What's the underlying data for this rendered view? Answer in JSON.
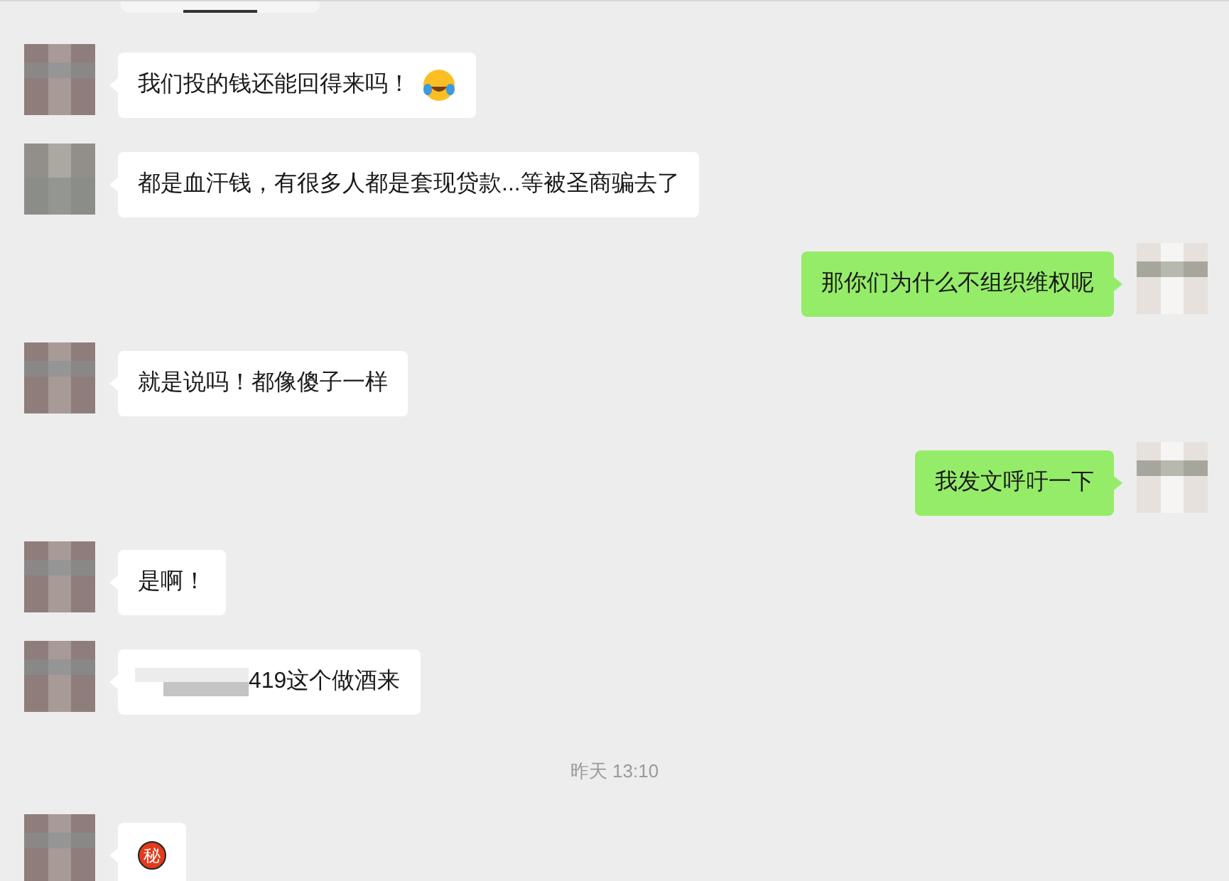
{
  "messages": [
    {
      "kind": "fragment"
    },
    {
      "kind": "text_emoji",
      "outgoing": false,
      "text": "我们投的钱还能回得来吗！"
    },
    {
      "kind": "text",
      "outgoing": false,
      "text": "都是血汗钱，有很多人都是套现贷款...等被圣商骗去了"
    },
    {
      "kind": "text",
      "outgoing": true,
      "text": "那你们为什么不组织维权呢"
    },
    {
      "kind": "text",
      "outgoing": false,
      "text": "就是说吗！都像傻子一样"
    },
    {
      "kind": "text",
      "outgoing": true,
      "text": "我发文呼吁一下"
    },
    {
      "kind": "text",
      "outgoing": false,
      "text": "是啊！"
    },
    {
      "kind": "blurred_prefix",
      "outgoing": false,
      "text": "419这个做酒来"
    },
    {
      "kind": "time",
      "text": "昨天 13:10"
    },
    {
      "kind": "seal",
      "outgoing": false,
      "text": "秘"
    }
  ]
}
